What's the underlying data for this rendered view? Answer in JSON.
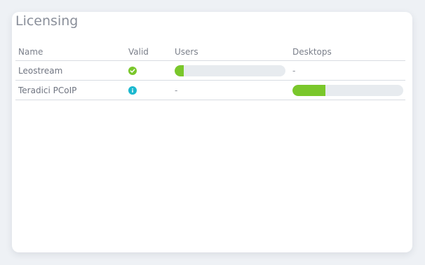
{
  "panel": {
    "title": "Licensing"
  },
  "table": {
    "headers": {
      "name": "Name",
      "valid": "Valid",
      "users": "Users",
      "desktops": "Desktops"
    },
    "rows": [
      {
        "name": "Leostream",
        "valid_icon": "check-circle-icon",
        "valid_color": "#7ac72b",
        "users_usage": 0.08,
        "users_text": "",
        "desktops_text": "-"
      },
      {
        "name": "Teradici PCoIP",
        "valid_icon": "info-circle-icon",
        "valid_color": "#1bb8cf",
        "users_text": "-",
        "desktops_usage": 0.3
      }
    ]
  },
  "colors": {
    "bar_fill": "#7ac72b",
    "bar_track": "#e7ebef"
  }
}
